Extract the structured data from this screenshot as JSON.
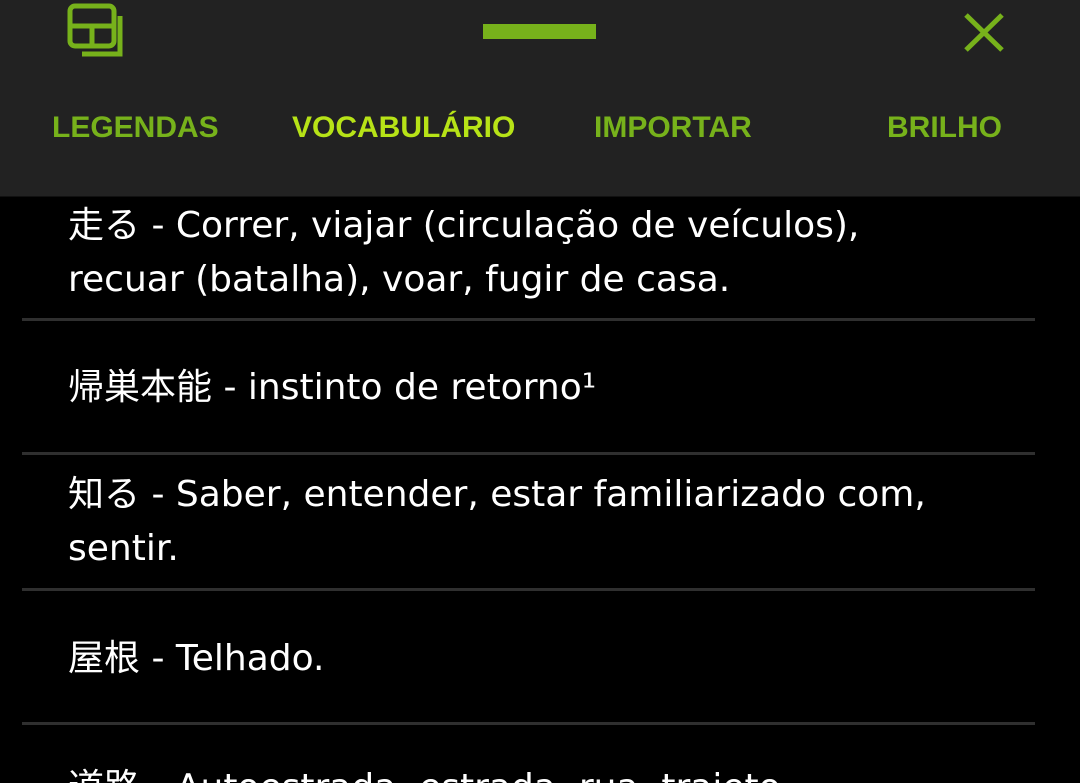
{
  "toolbar": {
    "layout_icon": "layout-window-icon",
    "handle_icon": "drag-handle-icon",
    "close_icon": "close-icon",
    "accent_color": "#77b21b",
    "active_color": "#b7e317"
  },
  "tabs": [
    {
      "label": "LEGENDAS",
      "active": false
    },
    {
      "label": "VOCABULÁRIO",
      "active": true
    },
    {
      "label": "IMPORTAR",
      "active": false
    },
    {
      "label": "BRILHO",
      "active": false
    }
  ],
  "vocabulary": [
    {
      "line1": "走る - Correr, viajar (circulação de veículos),",
      "line2": "recuar (batalha), voar, fugir de casa."
    },
    {
      "line1": "帰巣本能 - instinto de retorno¹",
      "line2": ""
    },
    {
      "line1": "知る - Saber, entender, estar familiarizado com,",
      "line2": "sentir."
    },
    {
      "line1": "屋根 - Telhado.",
      "line2": ""
    },
    {
      "line1": "道路 - Autoestrada, estrada, rua, trajeto.",
      "line2": ""
    }
  ]
}
